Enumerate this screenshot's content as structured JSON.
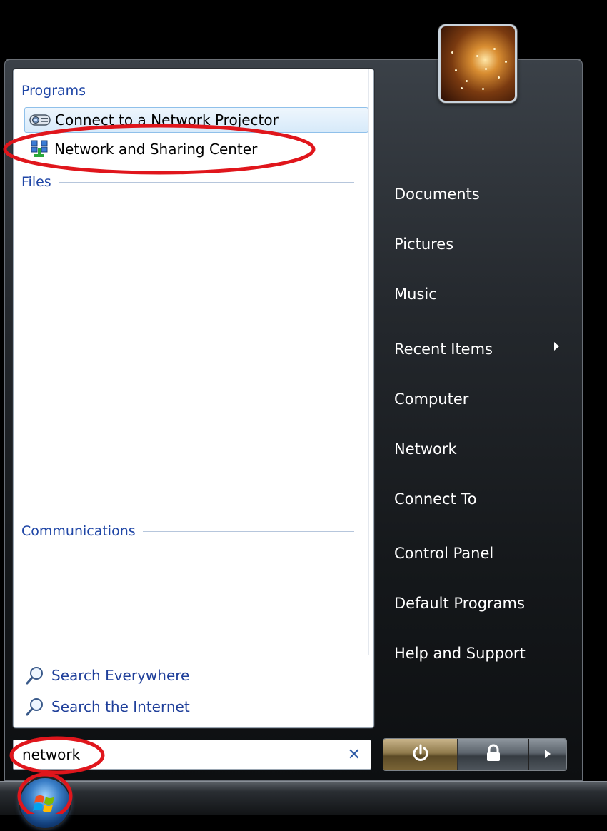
{
  "left_pane": {
    "groups": {
      "programs": "Programs",
      "files": "Files",
      "communications": "Communications"
    },
    "program_results": [
      {
        "label": "Connect to a Network Projector",
        "icon": "projector-icon",
        "selected": true
      },
      {
        "label": "Network and Sharing Center",
        "icon": "network-sharing-icon",
        "selected": false
      }
    ],
    "search_links": [
      {
        "label": "Search Everywhere",
        "icon": "magnifier-icon"
      },
      {
        "label": "Search the Internet",
        "icon": "magnifier-icon"
      }
    ]
  },
  "search": {
    "value": "network",
    "clear_icon": "clear-x-icon"
  },
  "right_pane": {
    "user_picture_icon": "user-picture",
    "items": [
      {
        "label": "Documents"
      },
      {
        "label": "Pictures"
      },
      {
        "label": "Music"
      },
      {
        "label": "Recent Items",
        "submenu": true
      },
      {
        "label": "Computer"
      },
      {
        "label": "Network"
      },
      {
        "label": "Connect To"
      },
      {
        "label": "Control Panel"
      },
      {
        "label": "Default Programs"
      },
      {
        "label": "Help and Support"
      }
    ]
  },
  "power_buttons": {
    "power_icon": "power-icon",
    "lock_icon": "lock-icon",
    "more_icon": "arrow-right-icon"
  },
  "taskbar": {
    "start_icon": "windows-start-orb-icon"
  },
  "colors": {
    "annotation": "#e0161c",
    "group_header": "#1f46a6",
    "link": "#1f3f9a"
  }
}
